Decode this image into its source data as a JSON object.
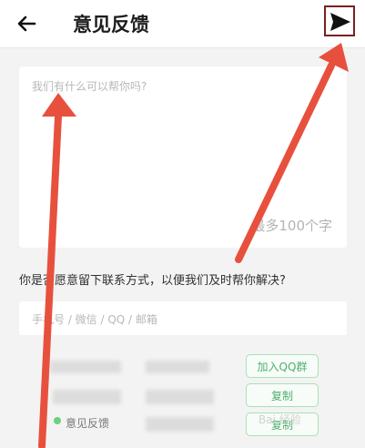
{
  "header": {
    "title": "意见反馈",
    "back_icon": "arrow-left-icon",
    "send_icon": "send-icon"
  },
  "feedback": {
    "placeholder": "我们有什么可以帮你吗?",
    "char_limit": "最多100个字"
  },
  "contact": {
    "question": "你是否愿意留下联系方式，以便我们及时帮你解决?",
    "placeholder": "手机号 / 微信 / QQ / 邮箱"
  },
  "actions": {
    "join_qq_group": "加入QQ群",
    "copy_1": "复制",
    "copy_2": "复制"
  },
  "footer": {
    "feedback_label": "意见反馈"
  },
  "watermark": "Bai 经验",
  "colors": {
    "arrow_red": "#e8503e",
    "send_border": "#7a2020",
    "green": "#4fb16d"
  }
}
